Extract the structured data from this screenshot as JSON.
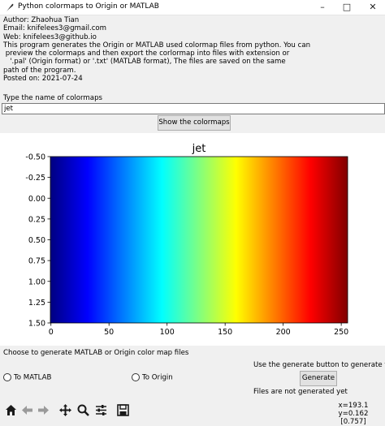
{
  "window": {
    "title": "Python colormaps to Origin or MATLAB",
    "controls": [
      "minimize-icon",
      "maximize-icon",
      "close-icon"
    ]
  },
  "info": {
    "author": "Author: Zhaohua Tian",
    "email": "Email: knifelees3@gmail.com",
    "web": "Web: knifelees3@github.io",
    "desc_line1": "This program generates the Origin or MATLAB used colormap files from python. You can",
    "desc_line2": " preview the colormaps and then export the corlormap into files with extension or",
    "desc_line3": "   '.pal' (Origin format) or '.txt' (MATLAB format), The files are saved on the same",
    "desc_line4": "path of the program.",
    "posted": "Posted on: 2021-07-24"
  },
  "colormap_input": {
    "label": "Type the name of colormaps",
    "value": "jet"
  },
  "show_button": "Show the colormaps",
  "chart_data": {
    "type": "heatmap",
    "title": "jet",
    "colormap": "jet",
    "x_range": [
      -0.5,
      255.5
    ],
    "y_range": [
      -0.5,
      1.5
    ],
    "x_ticks": [
      "0",
      "50",
      "100",
      "150",
      "200",
      "250"
    ],
    "x_tick_values": [
      0,
      50,
      100,
      150,
      200,
      250
    ],
    "y_ticks": [
      "-0.50",
      "-0.25",
      "0.00",
      "0.25",
      "0.50",
      "0.75",
      "1.00",
      "1.25",
      "1.50"
    ],
    "y_tick_values": [
      -0.5,
      -0.25,
      0,
      0.25,
      0.5,
      0.75,
      1.0,
      1.25,
      1.5
    ],
    "gradient_colors": [
      "#000080",
      "#0000ff",
      "#0080ff",
      "#00ffff",
      "#80ff80",
      "#ffff00",
      "#ff8000",
      "#ff0000",
      "#800000"
    ]
  },
  "export": {
    "label": "Choose to generate MATLAB or Origin color map files",
    "option_matlab": "To MATLAB",
    "option_origin": "To Origin",
    "hint": "Use the generate button to generate files",
    "generate_button": "Generate",
    "status": "Files are not generated yet"
  },
  "toolbar": {
    "icons": [
      "home-icon",
      "back-icon",
      "forward-icon",
      "pan-icon",
      "zoom-icon",
      "configure-icon",
      "save-icon"
    ],
    "coords_line1": "x=193.1 y=0.162",
    "coords_line2": "[0.757]"
  }
}
